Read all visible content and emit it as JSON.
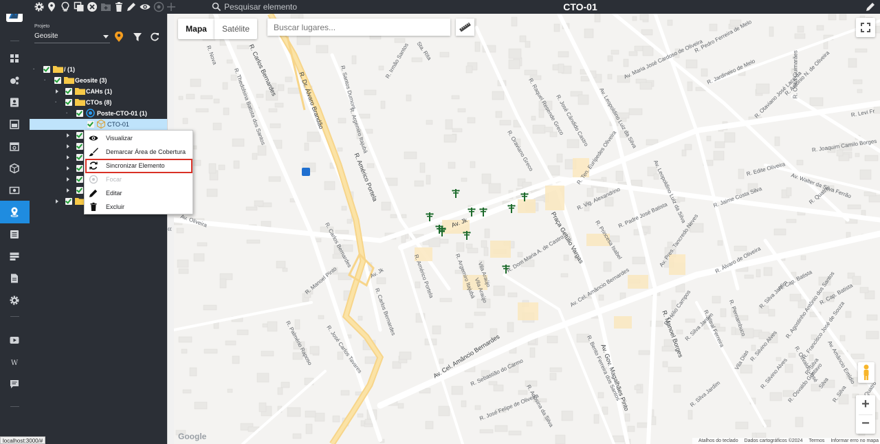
{
  "topbar": {
    "search_placeholder": "Pesquisar elemento",
    "title": "CTO-01",
    "icons": [
      "gear-icon",
      "map-pin-icon",
      "lightbulb-icon",
      "copy-icon",
      "close-circle-icon",
      "folder-plus-icon",
      "trash-icon",
      "pencil-icon",
      "eye-icon",
      "target-icon",
      "plus-icon"
    ]
  },
  "leftnav": {
    "icons": [
      "dashboard-icon",
      "network-icon",
      "contacts-icon",
      "board-icon",
      "calendar-icon",
      "box-icon",
      "money-icon",
      "map-location-icon",
      "list-icon",
      "server-icon",
      "document-icon",
      "settings-icon",
      "video-icon",
      "wiki-icon",
      "chat-icon"
    ],
    "active": "map-location-icon"
  },
  "panel": {
    "project_label": "Projeto",
    "project_value": "Geosite",
    "tree": [
      {
        "label": "/ (1)"
      },
      {
        "label": "Geosite (3)"
      },
      {
        "label": "CAHs (1)"
      },
      {
        "label": "CTOs (8)"
      },
      {
        "label": "Poste-CTO-01 (1)"
      },
      {
        "label": "CTO-01"
      }
    ]
  },
  "context_menu": {
    "items": [
      {
        "label": "Visualizar",
        "icon": "eye-icon"
      },
      {
        "label": "Demarcar Área de Cobertura",
        "icon": "brush-icon"
      },
      {
        "label": "Sincronizar Elemento",
        "icon": "sync-icon"
      },
      {
        "label": "Focar",
        "icon": "target-icon"
      },
      {
        "label": "Editar",
        "icon": "pencil-icon"
      },
      {
        "label": "Excluir",
        "icon": "trash-icon"
      }
    ],
    "highlighted": "Sincronizar Elemento"
  },
  "map": {
    "type_map": "Mapa",
    "type_satellite": "Satélite",
    "places_placeholder": "Buscar lugares...",
    "google": "Google",
    "attribution": {
      "shortcuts": "Atalhos do teclado",
      "data": "Dados cartográficos ©2024",
      "terms": "Termos",
      "report": "Informar erro no mapa"
    },
    "streets": [
      "R. Carlos Bernardes",
      "R. Dr. Álvaro Brandão",
      "R. Argemiro Itajubá",
      "R. Américo Portela",
      "R. Carlos Bernardes",
      "Av. Jk",
      "Av. Jk",
      "R. Américo Portela",
      "R. Argemiro Itajubá",
      "Vila Araújo",
      "R. Dom Maria A. de Castro",
      "Praça Getúlio Vargas",
      "R. Princesa Isabel",
      "R. Padre José Batista",
      "R. Vig. Alexandrino",
      "R. Ten. Eurípedes Oliveira",
      "R. Oraviano Greco",
      "R. Raquel Resende Greco",
      "R. José Cândido Castro",
      "Av. Leopoldino Luiz da Silva",
      "Av. Leopoldino Luiz da Silva",
      "Av. Maria José Cardoso de Oliveira",
      "R. Jardineiro de Melo",
      "R. Pedro Ferreira de Melo",
      "R. Antonio N. de Oliveira",
      "R. Otaviano José Lacerda",
      "R. Otília Guimarães",
      "R. Levi Fr",
      "R. Joaquim Camilo Borges",
      "Av. Walter da Silva Ferrão",
      "R. Edite Oliveira",
      "R. Quatro",
      "R. Jaime Costa Silva",
      "Av. Cel. Amâncio Bernardes",
      "Av. Cel. Amâncio Bernardes",
      "R. Manoel Borges",
      "Av. Gov. Magalhães Pinto",
      "R. Bento Ferreira dos Santos",
      "R. Sebastião do Carmo",
      "R. Adosina da Silva",
      "R. José Felipe de Oliveira",
      "R. José Carlos Tavares",
      "R. Manoel Pinto",
      "R. Palmério Raposo",
      "R. Cap. Batista",
      "R. Cap. Batista",
      "R. Álvaro de Oliveira",
      "Av. Pres. Tancredo Neves",
      "R. Hélio Campos",
      "R. Vitral Ferreira",
      "R. Pernambuco",
      "R. Silva Jardim",
      "R. Silva Jardim",
      "R. Silva Jardim",
      "Vila Dias",
      "R. Agostinho Antônio dos Santos",
      "R. Francisco José de Souza",
      "R. Quatro",
      "Av. Amâncio Emídio",
      "R. Nova",
      "R. Thedolsina Batista dos Santos",
      "R. Santos Dumont",
      "R. Irmão Santos",
      "Sta. Rita",
      "R. Osvaldo José",
      "R. Silvino Alves",
      "R. Silvino Alves",
      "R. Osvaldo Gustavo",
      "Av. Oliveira",
      "R. Silva",
      "Silva",
      "R. Silva",
      "Vila Araújo",
      "R. Carlos Bernardes"
    ],
    "poste_count": 11
  },
  "status_url": "localhost:3000/#"
}
